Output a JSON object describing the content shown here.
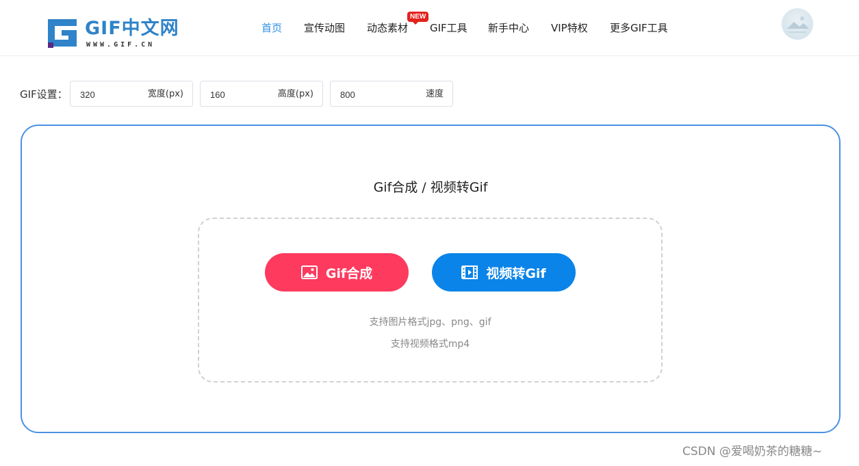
{
  "logo": {
    "name": "GIF中文网",
    "url_text": "WWW.GIF.CN"
  },
  "nav": {
    "items": [
      {
        "label": "首页",
        "active": true
      },
      {
        "label": "宣传动图"
      },
      {
        "label": "动态素材"
      },
      {
        "label": "GIF工具"
      },
      {
        "label": "新手中心"
      },
      {
        "label": "VIP特权"
      },
      {
        "label": "更多GIF工具"
      }
    ],
    "badge": "NEW"
  },
  "settings": {
    "label": "GIF设置：",
    "width": {
      "value": "320",
      "unit": "宽度(px)"
    },
    "height": {
      "value": "160",
      "unit": "高度(px)"
    },
    "speed": {
      "value": "800",
      "unit": "速度"
    }
  },
  "panel": {
    "title": "Gif合成 / 视频转Gif",
    "gif_button": "Gif合成",
    "video_button": "视频转Gif",
    "hint_images": "支持图片格式jpg、png、gif",
    "hint_video": "支持视频格式mp4"
  },
  "watermark": "CSDN @爱喝奶茶的糖糖~",
  "colors": {
    "accent": "#2d8ee0",
    "gif_button": "#fe3a5e",
    "video_button": "#0a84e8",
    "panel_border": "#4a90e2",
    "badge": "#e4211c"
  }
}
